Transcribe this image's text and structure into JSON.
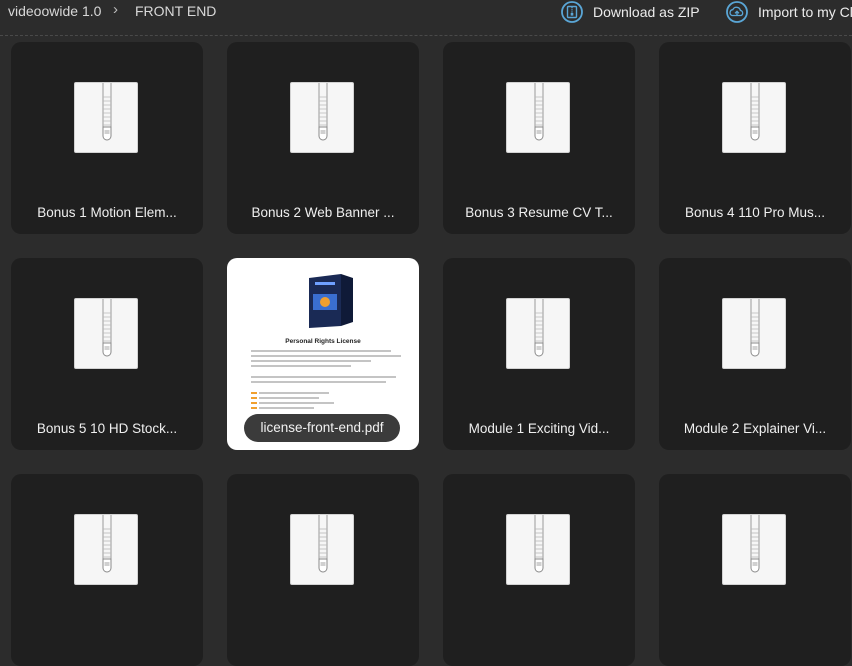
{
  "breadcrumb": {
    "root": "videoowide 1.0",
    "separator": "›",
    "current": "FRONT END"
  },
  "actions": {
    "download_zip": "Download as ZIP",
    "import": "Import to my Cl"
  },
  "accent_color": "#5aa6d6",
  "files": [
    {
      "label": "Bonus 1 Motion Elem...",
      "type": "zip"
    },
    {
      "label": "Bonus 2 Web Banner ...",
      "type": "zip"
    },
    {
      "label": "Bonus 3 Resume CV T...",
      "type": "zip"
    },
    {
      "label": "Bonus 4 110 Pro Mus...",
      "type": "zip"
    },
    {
      "label": "Bonus 5 10 HD Stock...",
      "type": "zip"
    },
    {
      "label": "license-front-end.pdf",
      "type": "pdf",
      "preview_title": "Personal Rights License"
    },
    {
      "label": "Module 1 Exciting Vid...",
      "type": "zip"
    },
    {
      "label": "Module 2 Explainer Vi...",
      "type": "zip"
    },
    {
      "label": "",
      "type": "zip"
    },
    {
      "label": "",
      "type": "zip"
    },
    {
      "label": "",
      "type": "zip"
    },
    {
      "label": "",
      "type": "zip"
    }
  ]
}
